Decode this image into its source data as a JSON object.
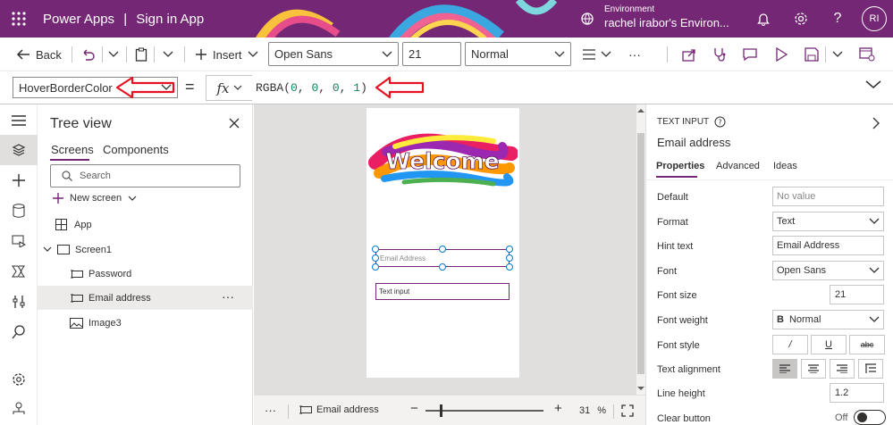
{
  "header": {
    "app_name": "Power Apps",
    "separator": "|",
    "page_name": "Sign in App",
    "environment_label": "Environment",
    "environment_name": "rachel irabor's Environ...",
    "avatar_initials": "RI"
  },
  "toolbar": {
    "back_label": "Back",
    "insert_label": "Insert",
    "font_family": "Open Sans",
    "font_size": "21",
    "font_weight": "Normal",
    "more": "···"
  },
  "formula_bar": {
    "property": "HoverBorderColor",
    "equals": "=",
    "fx": "fx",
    "formula_fn": "RGBA(",
    "formula_args": [
      "0",
      "0",
      "0",
      "1"
    ],
    "formula_close": ")"
  },
  "tree": {
    "title": "Tree view",
    "tabs": [
      "Screens",
      "Components"
    ],
    "search_placeholder": "Search",
    "new_screen": "New screen",
    "items": [
      {
        "label": "App"
      },
      {
        "label": "Screen1"
      },
      {
        "label": "Password"
      },
      {
        "label": "Email address"
      },
      {
        "label": "Image3"
      }
    ],
    "item_more": "···"
  },
  "canvas": {
    "welcome_text": "Welcome",
    "email_hint": "Email Address",
    "text_input_default": "Text input"
  },
  "statusbar": {
    "more": "···",
    "selected": "Email address",
    "zoom_minus": "−",
    "zoom_plus": "+",
    "zoom_value": "31",
    "zoom_unit": "%"
  },
  "properties": {
    "control_type": "TEXT INPUT",
    "control_name": "Email address",
    "tabs": [
      "Properties",
      "Advanced",
      "Ideas"
    ],
    "rows": [
      {
        "label": "Default",
        "value": "No value"
      },
      {
        "label": "Format",
        "value": "Text"
      },
      {
        "label": "Hint text",
        "value": "Email Address"
      },
      {
        "label": "Font",
        "value": "Open Sans"
      },
      {
        "label": "Font size",
        "value": "21"
      },
      {
        "label": "Font weight",
        "value": "Normal",
        "prefix": "B"
      },
      {
        "label": "Font style"
      },
      {
        "label": "Text alignment"
      },
      {
        "label": "Line height",
        "value": "1.2"
      },
      {
        "label": "Clear button",
        "value": "Off"
      }
    ],
    "font_style_buttons": [
      "/",
      "U",
      "abc"
    ]
  },
  "colors": {
    "brand": "#742774",
    "annotation": "#e81123",
    "selection": "#0078d4"
  }
}
